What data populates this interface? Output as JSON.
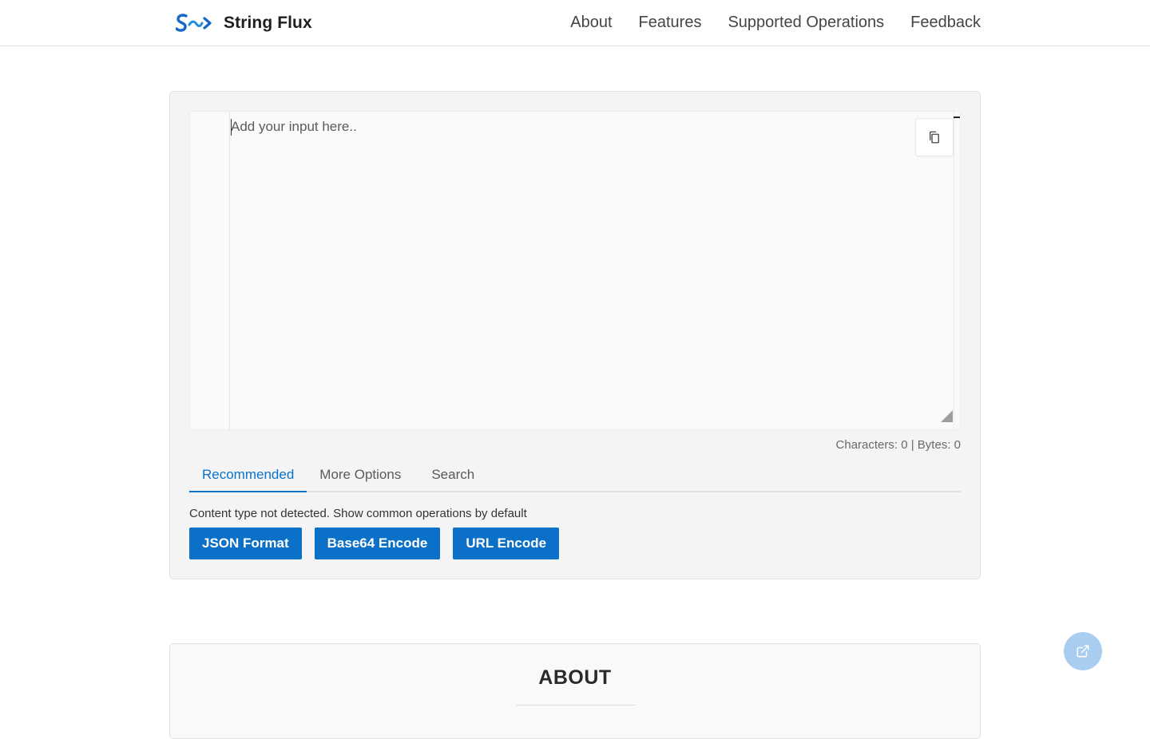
{
  "header": {
    "logo_icon": "s-wave-arrow-logo",
    "brand_name": "String Flux",
    "nav": [
      {
        "label": "About"
      },
      {
        "label": "Features"
      },
      {
        "label": "Supported Operations"
      },
      {
        "label": "Feedback"
      }
    ]
  },
  "editor": {
    "value": "",
    "placeholder": "Add your input here..",
    "copy_icon": "copy-icon"
  },
  "stats": {
    "text": "Characters: 0 | Bytes: 0",
    "characters": 0,
    "bytes": 0
  },
  "tabs": [
    {
      "label": "Recommended",
      "active": true
    },
    {
      "label": "More Options",
      "active": false
    },
    {
      "label": "Search",
      "active": false,
      "icon": "search-icon",
      "glyph": ""
    }
  ],
  "recommended": {
    "hint": "Content type not detected. Show common operations by default",
    "operations": [
      {
        "label": "JSON Format"
      },
      {
        "label": "Base64 Encode"
      },
      {
        "label": "URL Encode"
      }
    ]
  },
  "about": {
    "title": "ABOUT"
  },
  "fab": {
    "icon": "external-link-icon"
  },
  "colors": {
    "accent": "#0a70c8",
    "active_tab": "#0a72c9",
    "fab": "#a9cdef",
    "card_bg": "#f4f4f4"
  }
}
